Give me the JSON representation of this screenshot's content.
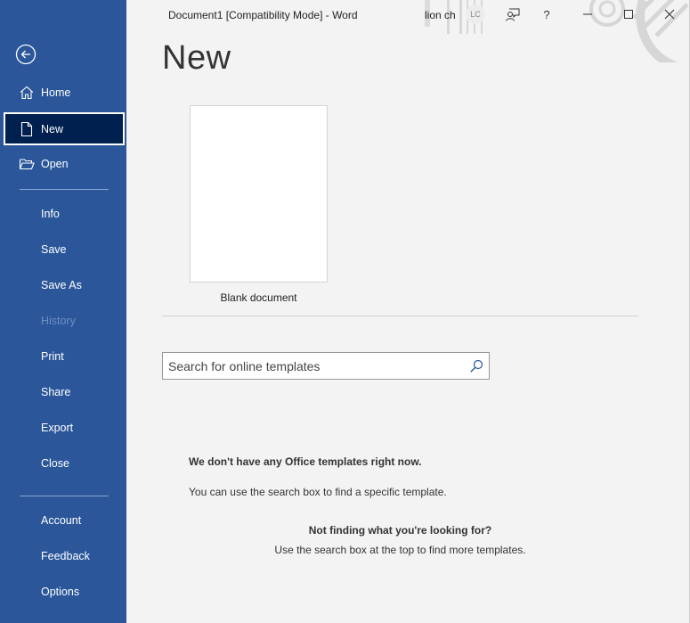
{
  "window": {
    "title": "Document1 [Compatibility Mode]  -  Word",
    "user_name": "lion ch",
    "user_initials": "LC"
  },
  "sidebar": {
    "items": [
      {
        "label": "Home",
        "icon": "home-icon"
      },
      {
        "label": "New",
        "icon": "new-document-icon",
        "selected": true
      },
      {
        "label": "Open",
        "icon": "folder-open-icon"
      },
      {
        "label": "Info"
      },
      {
        "label": "Save"
      },
      {
        "label": "Save As"
      },
      {
        "label": "History",
        "disabled": true
      },
      {
        "label": "Print"
      },
      {
        "label": "Share"
      },
      {
        "label": "Export"
      },
      {
        "label": "Close"
      },
      {
        "label": "Account"
      },
      {
        "label": "Feedback"
      },
      {
        "label": "Options"
      }
    ]
  },
  "main": {
    "heading": "New",
    "templates": [
      {
        "label": "Blank document"
      }
    ],
    "search": {
      "placeholder": "Search for online templates",
      "value": ""
    },
    "messages": {
      "no_templates": "We don't have any Office templates right now.",
      "use_search": "You can use the search box to find a specific template.",
      "not_finding": "Not finding what you're looking for?",
      "use_top_search": "Use the search box at the top to find more templates."
    }
  },
  "colors": {
    "sidebar_bg": "#2b579a",
    "selected_bg": "#002050",
    "page_bg": "#f3f3f3"
  }
}
